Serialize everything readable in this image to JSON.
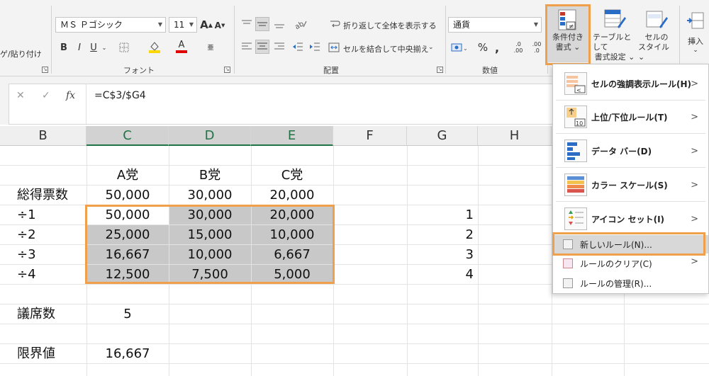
{
  "ribbon": {
    "clipboard": {
      "paste_label": "ゲ/貼り付け"
    },
    "font": {
      "group_label": "フォント",
      "font_name": "ＭＳ Ｐゴシック",
      "font_size": "11",
      "grow_label": "A",
      "shrink_label": "A",
      "bold": "B",
      "italic": "I",
      "underline": "U",
      "font_color_letter": "A",
      "phonetic_letter": "亜"
    },
    "alignment": {
      "group_label": "配置",
      "wrap_text": "折り返して全体を表示する",
      "merge_center": "セルを結合して中央揃え"
    },
    "number": {
      "group_label": "数値",
      "format": "通貨",
      "percent": "%",
      "comma": ",",
      "inc_decimal": ".00",
      "dec_decimal": ".0"
    },
    "styles": {
      "conditional_formatting": [
        "条件付き",
        "書式"
      ],
      "format_as_table": [
        "テーブルとして",
        "書式設定"
      ],
      "cell_styles": [
        "セルの",
        "スタイル"
      ]
    },
    "cells": {
      "insert": "挿入"
    }
  },
  "formula_bar": {
    "cancel": "✕",
    "enter": "✓",
    "fx": "fx",
    "formula": "=C$3/$G4"
  },
  "columns": [
    "B",
    "C",
    "D",
    "E",
    "F",
    "G",
    "H"
  ],
  "sheet": {
    "headers": [
      "A党",
      "B党",
      "C党"
    ],
    "total_label": "総得票数",
    "totals": [
      "50,000",
      "30,000",
      "20,000"
    ],
    "rows": [
      {
        "label": "÷1",
        "values": [
          "50,000",
          "30,000",
          "20,000"
        ],
        "g": "1"
      },
      {
        "label": "÷2",
        "values": [
          "25,000",
          "15,000",
          "10,000"
        ],
        "g": "2"
      },
      {
        "label": "÷3",
        "values": [
          "16,667",
          "10,000",
          "6,667"
        ],
        "g": "3"
      },
      {
        "label": "÷4",
        "values": [
          "12,500",
          "7,500",
          "5,000"
        ],
        "g": "4"
      }
    ],
    "seats_label": "議席数",
    "seats_value": "5",
    "threshold_label": "限界値",
    "threshold_value": "16,667"
  },
  "menu": {
    "items": [
      {
        "label": "セルの強調表示ルール(H)",
        "icon": "highlight-rules-icon"
      },
      {
        "label": "上位/下位ルール(T)",
        "icon": "top-bottom-rules-icon"
      },
      {
        "label": "データ バー(D)",
        "icon": "data-bars-icon"
      },
      {
        "label": "カラー スケール(S)",
        "icon": "color-scales-icon"
      },
      {
        "label": "アイコン セット(I)",
        "icon": "icon-sets-icon"
      }
    ],
    "new_rule": "新しいルール(N)...",
    "clear_rules": "ルールのクリア(C)",
    "manage_rules": "ルールの管理(R)..."
  },
  "colors": {
    "highlight": "#f0a04b",
    "accent_green": "#217346",
    "selection_gray": "#c8c8c8"
  }
}
